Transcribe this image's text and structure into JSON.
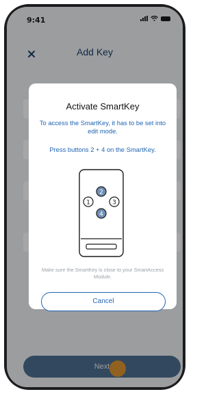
{
  "status_bar": {
    "time": "9:41"
  },
  "header": {
    "title": "Add Key"
  },
  "modal": {
    "title": "Activate SmartKey",
    "description": "To access the SmartKey, it has to be set into edit mode.",
    "instruction": "Press buttons 2 + 4 on the SmartKey.",
    "key_buttons": [
      "1",
      "2",
      "3",
      "4"
    ],
    "note": "Make sure the SmartKey is close to your SmartAccess Module.",
    "cancel_label": "Cancel"
  },
  "footer": {
    "next_label": "Next"
  },
  "colors": {
    "accent": "#1f64b3",
    "title_color": "#1c3f6b",
    "highlight_button": "#6f8fb5",
    "touch_indicator": "#f09a27",
    "next_button": "#4e6f92"
  }
}
